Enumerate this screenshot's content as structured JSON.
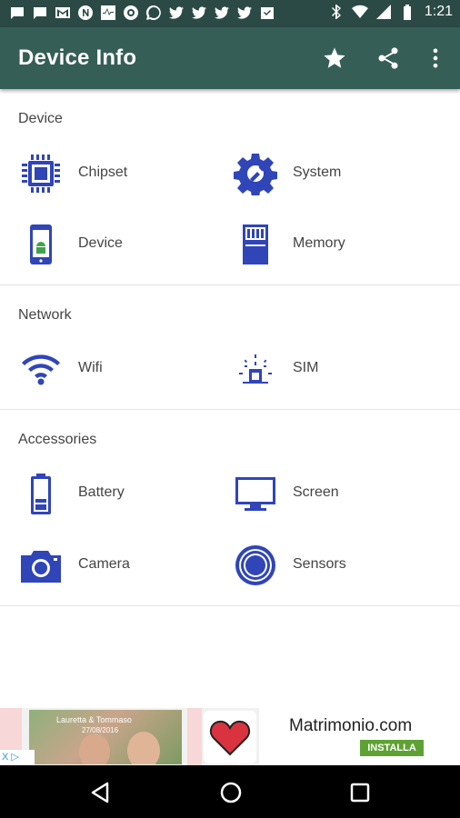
{
  "status_bar": {
    "time": "1:21",
    "left_icons": [
      "message-icon",
      "message-icon",
      "gmail-icon",
      "n-icon",
      "pulse-icon",
      "image-icon",
      "whatsapp-icon",
      "twitter-icon",
      "twitter-icon",
      "twitter-icon",
      "twitter-icon",
      "checkmail-icon"
    ],
    "right_icons": [
      "bluetooth-icon",
      "wifi-icon",
      "cell-signal-icon",
      "battery-icon"
    ]
  },
  "app_bar": {
    "title": "Device Info",
    "actions": [
      "star-icon",
      "share-icon",
      "more-vert-icon"
    ]
  },
  "sections": [
    {
      "title": "Device",
      "items": [
        {
          "label": "Chipset",
          "icon": "chip-icon"
        },
        {
          "label": "System",
          "icon": "system-gear-icon"
        },
        {
          "label": "Device",
          "icon": "android-phone-icon"
        },
        {
          "label": "Memory",
          "icon": "sd-card-icon"
        }
      ]
    },
    {
      "title": "Network",
      "items": [
        {
          "label": "Wifi",
          "icon": "wifi-icon"
        },
        {
          "label": "SIM",
          "icon": "sim-tower-icon"
        }
      ]
    },
    {
      "title": "Accessories",
      "items": [
        {
          "label": "Battery",
          "icon": "battery-icon"
        },
        {
          "label": "Screen",
          "icon": "monitor-icon"
        },
        {
          "label": "Camera",
          "icon": "camera-icon"
        },
        {
          "label": "Sensors",
          "icon": "sensor-icon"
        }
      ]
    }
  ],
  "ad": {
    "caption_names": "Lauretta & Tommaso",
    "caption_date": "27/08/2016",
    "brand": "Matrimonio.com",
    "install_label": "INSTALLA",
    "adchoices": "X ▷"
  },
  "nav_bar": [
    "back-icon",
    "home-icon",
    "recents-icon"
  ],
  "colors": {
    "status_bar": "#2b4a45",
    "app_bar": "#355e57",
    "icon_accent": "#2f45b8",
    "install_button": "#5fa234"
  }
}
